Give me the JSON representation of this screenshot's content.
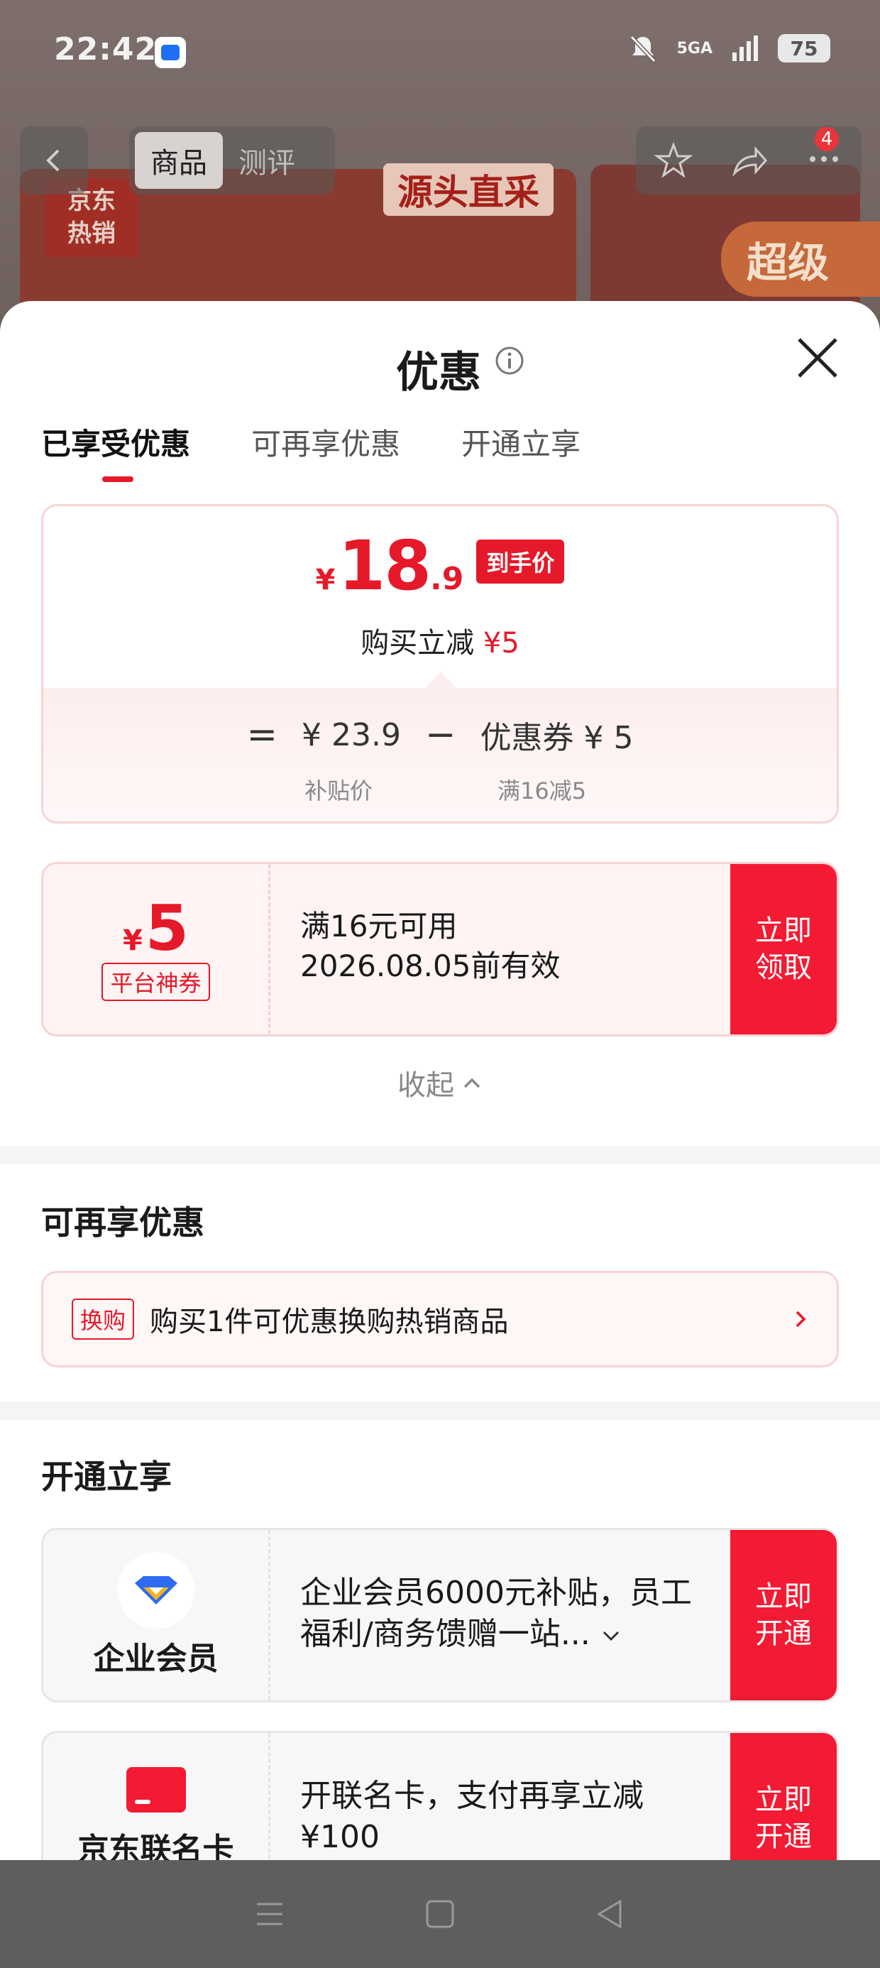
{
  "status_bar": {
    "time": "22:42",
    "network": "5GA",
    "battery": "75",
    "icons": [
      "app-icon",
      "mute-bell-icon",
      "signal-icon",
      "battery-icon"
    ]
  },
  "top_nav": {
    "tabs": [
      {
        "label": "商品",
        "active": true
      },
      {
        "label": "测评",
        "active": false
      }
    ],
    "cart_badge": "4",
    "icons": [
      "back-arrow-icon",
      "star-icon",
      "share-icon",
      "more-icon"
    ]
  },
  "banner": {
    "tag_line1": "京东",
    "tag_line2": "热销",
    "slogan": "源头直采",
    "right_text": "超级"
  },
  "sheet": {
    "title": "优惠",
    "tabs": [
      "已享受优惠",
      "可再享优惠",
      "开通立享"
    ],
    "active_tab": 0
  },
  "price_card": {
    "yen": "¥",
    "price_int": "18",
    "price_dec": ".9",
    "price_tag": "到手价",
    "reduce_prefix": "购买立减",
    "reduce_amount": "¥5",
    "eq": "=",
    "base_price": "¥ 23.9",
    "base_label": "补贴价",
    "minus": "−",
    "coupon_price": "优惠券 ¥ 5",
    "coupon_label": "满16减5"
  },
  "coupon": {
    "yen": "¥",
    "amount": "5",
    "type": "平台神券",
    "condition": "满16元可用",
    "expiry": "2026.08.05前有效",
    "button": "立即领取"
  },
  "collapse_label": "收起",
  "more_offers": {
    "title": "可再享优惠",
    "tag": "换购",
    "text": "购买1件可优惠换购热销商品"
  },
  "open_offers": {
    "title": "开通立享",
    "cards": [
      {
        "name": "企业会员",
        "desc": "企业会员6000元补贴，员工福利/商务馈赠一站...",
        "button": "立即开通"
      },
      {
        "name": "京东联名卡",
        "desc": "开联名卡，支付再享立减 ¥100",
        "button": "立即开通"
      }
    ]
  },
  "colors": {
    "accent_red": "#e5192a",
    "button_red": "#f21b33",
    "card_border": "#f8d3d6"
  }
}
